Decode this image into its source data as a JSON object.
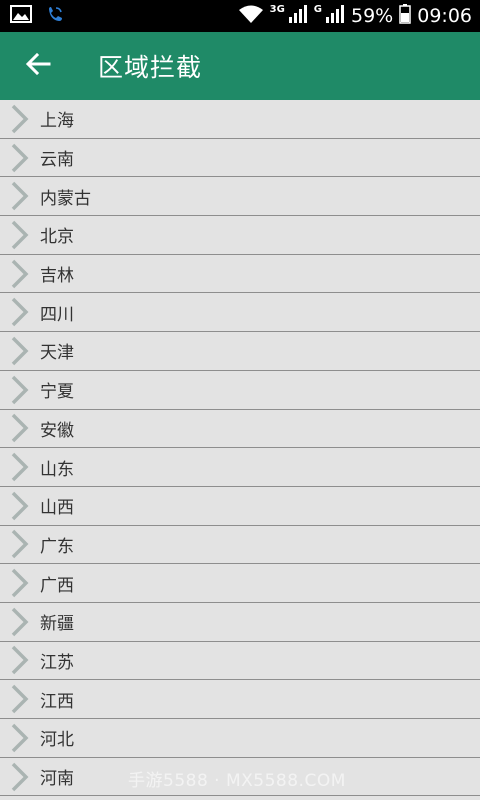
{
  "status_bar": {
    "network_3g": "3G",
    "network_g": "G",
    "battery": "59%",
    "time": "09:06"
  },
  "app_bar": {
    "title": "区域拦截"
  },
  "regions": [
    {
      "label": "上海"
    },
    {
      "label": "云南"
    },
    {
      "label": "内蒙古"
    },
    {
      "label": "北京"
    },
    {
      "label": "吉林"
    },
    {
      "label": "四川"
    },
    {
      "label": "天津"
    },
    {
      "label": "宁夏"
    },
    {
      "label": "安徽"
    },
    {
      "label": "山东"
    },
    {
      "label": "山西"
    },
    {
      "label": "广东"
    },
    {
      "label": "广西"
    },
    {
      "label": "新疆"
    },
    {
      "label": "江苏"
    },
    {
      "label": "江西"
    },
    {
      "label": "河北"
    },
    {
      "label": "河南"
    }
  ],
  "watermark": "手游5588 · MX5588.COM",
  "colors": {
    "app_bar": "#1f8a67",
    "list_bg": "#e3e3e3",
    "chevron": "#aab4b2"
  }
}
